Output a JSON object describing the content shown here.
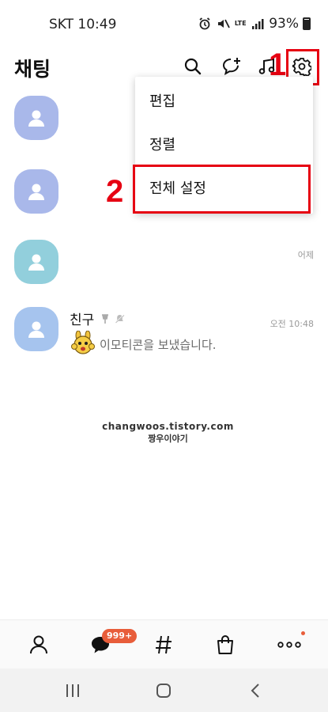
{
  "status_bar": {
    "carrier_time": "SKT 10:49",
    "network": "LTE",
    "battery": "93%"
  },
  "header": {
    "title": "채팅"
  },
  "annotations": {
    "step1": "1",
    "step2": "2"
  },
  "dropdown": {
    "items": [
      {
        "label": "편집"
      },
      {
        "label": "정렬"
      },
      {
        "label": "전체 설정"
      }
    ]
  },
  "chats": [
    {
      "name": "",
      "time": "",
      "message": "",
      "avatar_color": "#a9b8ea"
    },
    {
      "name": "",
      "time": "",
      "message": "",
      "avatar_color": "#a9b8ea"
    },
    {
      "name": "",
      "time": "어제",
      "message": "",
      "avatar_color": "#92cfdc"
    },
    {
      "name": "친구",
      "time": "오전 10:48",
      "message": "이모티콘을 보냈습니다.",
      "avatar_color": "#a6c4ee"
    }
  ],
  "watermark": {
    "line1": "changwoos.tistory.com",
    "line2": "짱우이야기"
  },
  "bottom_nav": {
    "chat_badge": "999+"
  },
  "colors": {
    "accent_red": "#e60012",
    "badge": "#e85d3a"
  }
}
